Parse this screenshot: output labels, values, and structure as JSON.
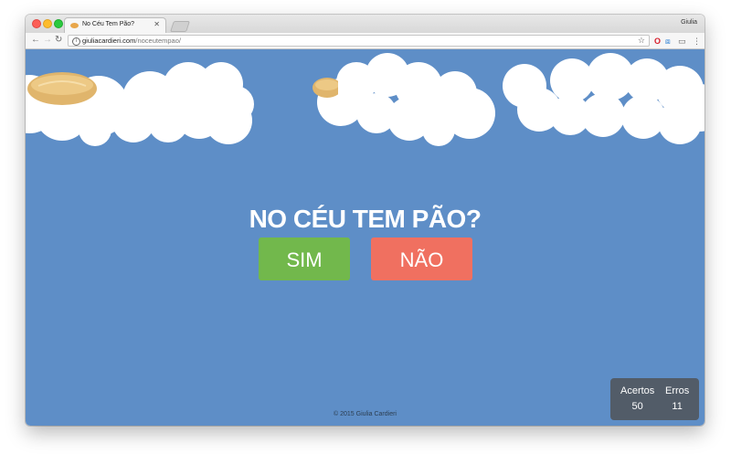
{
  "browser": {
    "tab_title": "No Céu Tem Pão?",
    "user_name": "Giulia",
    "url_host": "giuliacardieri.com",
    "url_path": "/noceutempao/"
  },
  "game": {
    "question": "NO CÉU TEM PÃO?",
    "yes_label": "SIM",
    "no_label": "NÃO",
    "footer": "© 2015 Giulia Cardieri"
  },
  "score": {
    "hits_label": "Acertos",
    "hits_value": "50",
    "errors_label": "Erros",
    "errors_value": "11"
  },
  "colors": {
    "sky": "#5e8ec7",
    "yes": "#72b84c",
    "no": "#f07060",
    "score_bg": "#525c68"
  }
}
